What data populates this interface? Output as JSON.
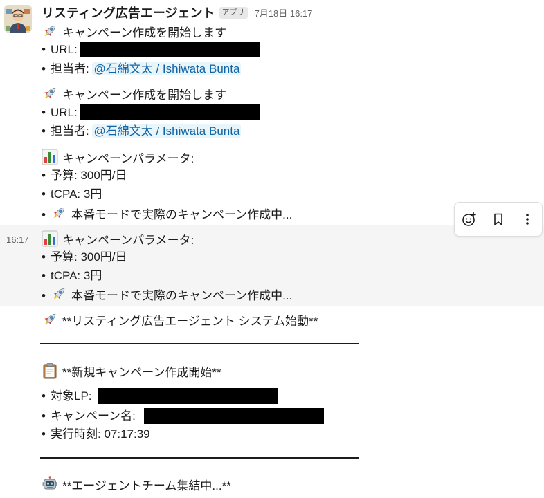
{
  "message": {
    "sender": "リスティング広告エージェント",
    "app_badge": "アプリ",
    "timestamp": "7月18日 16:17",
    "hover_time": "16:17"
  },
  "blocks": {
    "b1_title": "キャンペーン作成を開始します",
    "b1_url": "URL:",
    "b1_owner_label": "担当者:",
    "b1_mention": "@石綿文太 / Ishiwata Bunta",
    "b2_title": "キャンペーン作成を開始します",
    "b2_url": "URL:",
    "b2_owner_label": "担当者:",
    "b2_mention": "@石綿文太 / Ishiwata Bunta",
    "b3_title": "キャンペーンパラメータ:",
    "b3_budget": "予算: 300円/日",
    "b3_tcpa": "tCPA: 3円",
    "b3_mode": "本番モードで実際のキャンペーン作成中...",
    "b4_title": "キャンペーンパラメータ:",
    "b4_budget": "予算: 300円/日",
    "b4_tcpa": "tCPA: 3円",
    "b4_mode": "本番モードで実際のキャンペーン作成中...",
    "b5_title": "**リスティング広告エージェント システム始動**",
    "b6_title": "**新規キャンペーン作成開始**",
    "b6_lp": "対象LP:",
    "b6_campaign": "キャンペーン名:",
    "b6_time": "実行時刻: 07:17:39",
    "b7_title": "**エージェントチーム集結中...**"
  },
  "bullet_char": "•",
  "icons": [
    "rocket-icon",
    "bar-chart-icon",
    "clipboard-icon",
    "robot-icon",
    "add-reaction-icon",
    "bookmark-icon",
    "more-icon"
  ],
  "colors": {
    "mention_text": "#1264a3",
    "mention_bg": "#e8f5fa",
    "hover_bg": "#f5f5f5"
  }
}
